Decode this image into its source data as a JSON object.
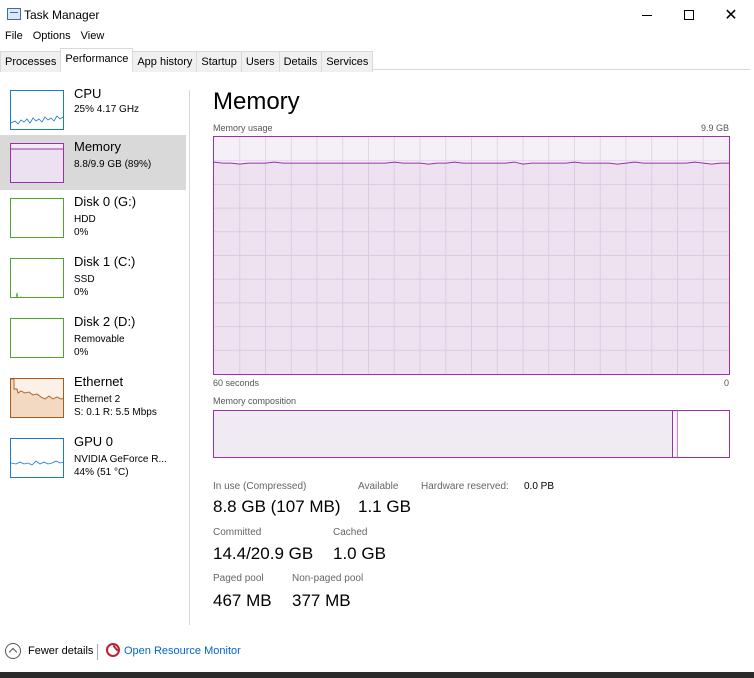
{
  "window": {
    "title": "Task Manager",
    "controls": {
      "minimize": "—",
      "maximize": "☐",
      "close": "✕"
    }
  },
  "menu": [
    "File",
    "Options",
    "View"
  ],
  "tabs": [
    {
      "label": "Processes"
    },
    {
      "label": "Performance",
      "active": true
    },
    {
      "label": "App history"
    },
    {
      "label": "Startup"
    },
    {
      "label": "Users"
    },
    {
      "label": "Details"
    },
    {
      "label": "Services"
    }
  ],
  "sidebar": {
    "items": [
      {
        "name": "CPU",
        "line1": "25% 4.17 GHz",
        "line2": "",
        "line3": "",
        "color": "#1a79c9"
      },
      {
        "name": "Memory",
        "line1": "8.8/9.9 GB (89%)",
        "line2": "",
        "line3": "",
        "color": "#9b2fae",
        "selected": true
      },
      {
        "name": "Disk 0 (G:)",
        "line1": "HDD",
        "line2": "0%",
        "line3": "",
        "color": "#4da62b"
      },
      {
        "name": "Disk 1 (C:)",
        "line1": "SSD",
        "line2": "0%",
        "line3": "",
        "color": "#4da62b"
      },
      {
        "name": "Disk 2 (D:)",
        "line1": "Removable",
        "line2": "0%",
        "line3": "",
        "color": "#4da62b"
      },
      {
        "name": "Ethernet",
        "line1": "Ethernet 2",
        "line2": "S: 0.1 R: 5.5 Mbps",
        "line3": "",
        "color": "#a75a1b"
      },
      {
        "name": "GPU 0",
        "line1": "NVIDIA GeForce R...",
        "line2": "44% (51 °C)",
        "line3": "",
        "color": "#1a79c9"
      }
    ]
  },
  "main": {
    "title": "Memory",
    "usage_label": "Memory usage",
    "usage_max": "9.9 GB",
    "time_label": "60 seconds",
    "time_end": "0",
    "composition_label": "Memory composition",
    "memory_usage_fraction": 0.89
  },
  "stats": {
    "in_use_label": "In use (Compressed)",
    "in_use_value": "8.8 GB (107 MB)",
    "available_label": "Available",
    "available_value": "1.1 GB",
    "hw_reserved_label": "Hardware reserved:",
    "hw_reserved_value": "0.0 PB",
    "committed_label": "Committed",
    "committed_value": "14.4/20.9 GB",
    "cached_label": "Cached",
    "cached_value": "1.0 GB",
    "paged_label": "Paged pool",
    "paged_value": "467 MB",
    "nonpaged_label": "Non-paged pool",
    "nonpaged_value": "377 MB"
  },
  "footer": {
    "fewer_details": "Fewer details",
    "resource_monitor": "Open Resource Monitor"
  }
}
